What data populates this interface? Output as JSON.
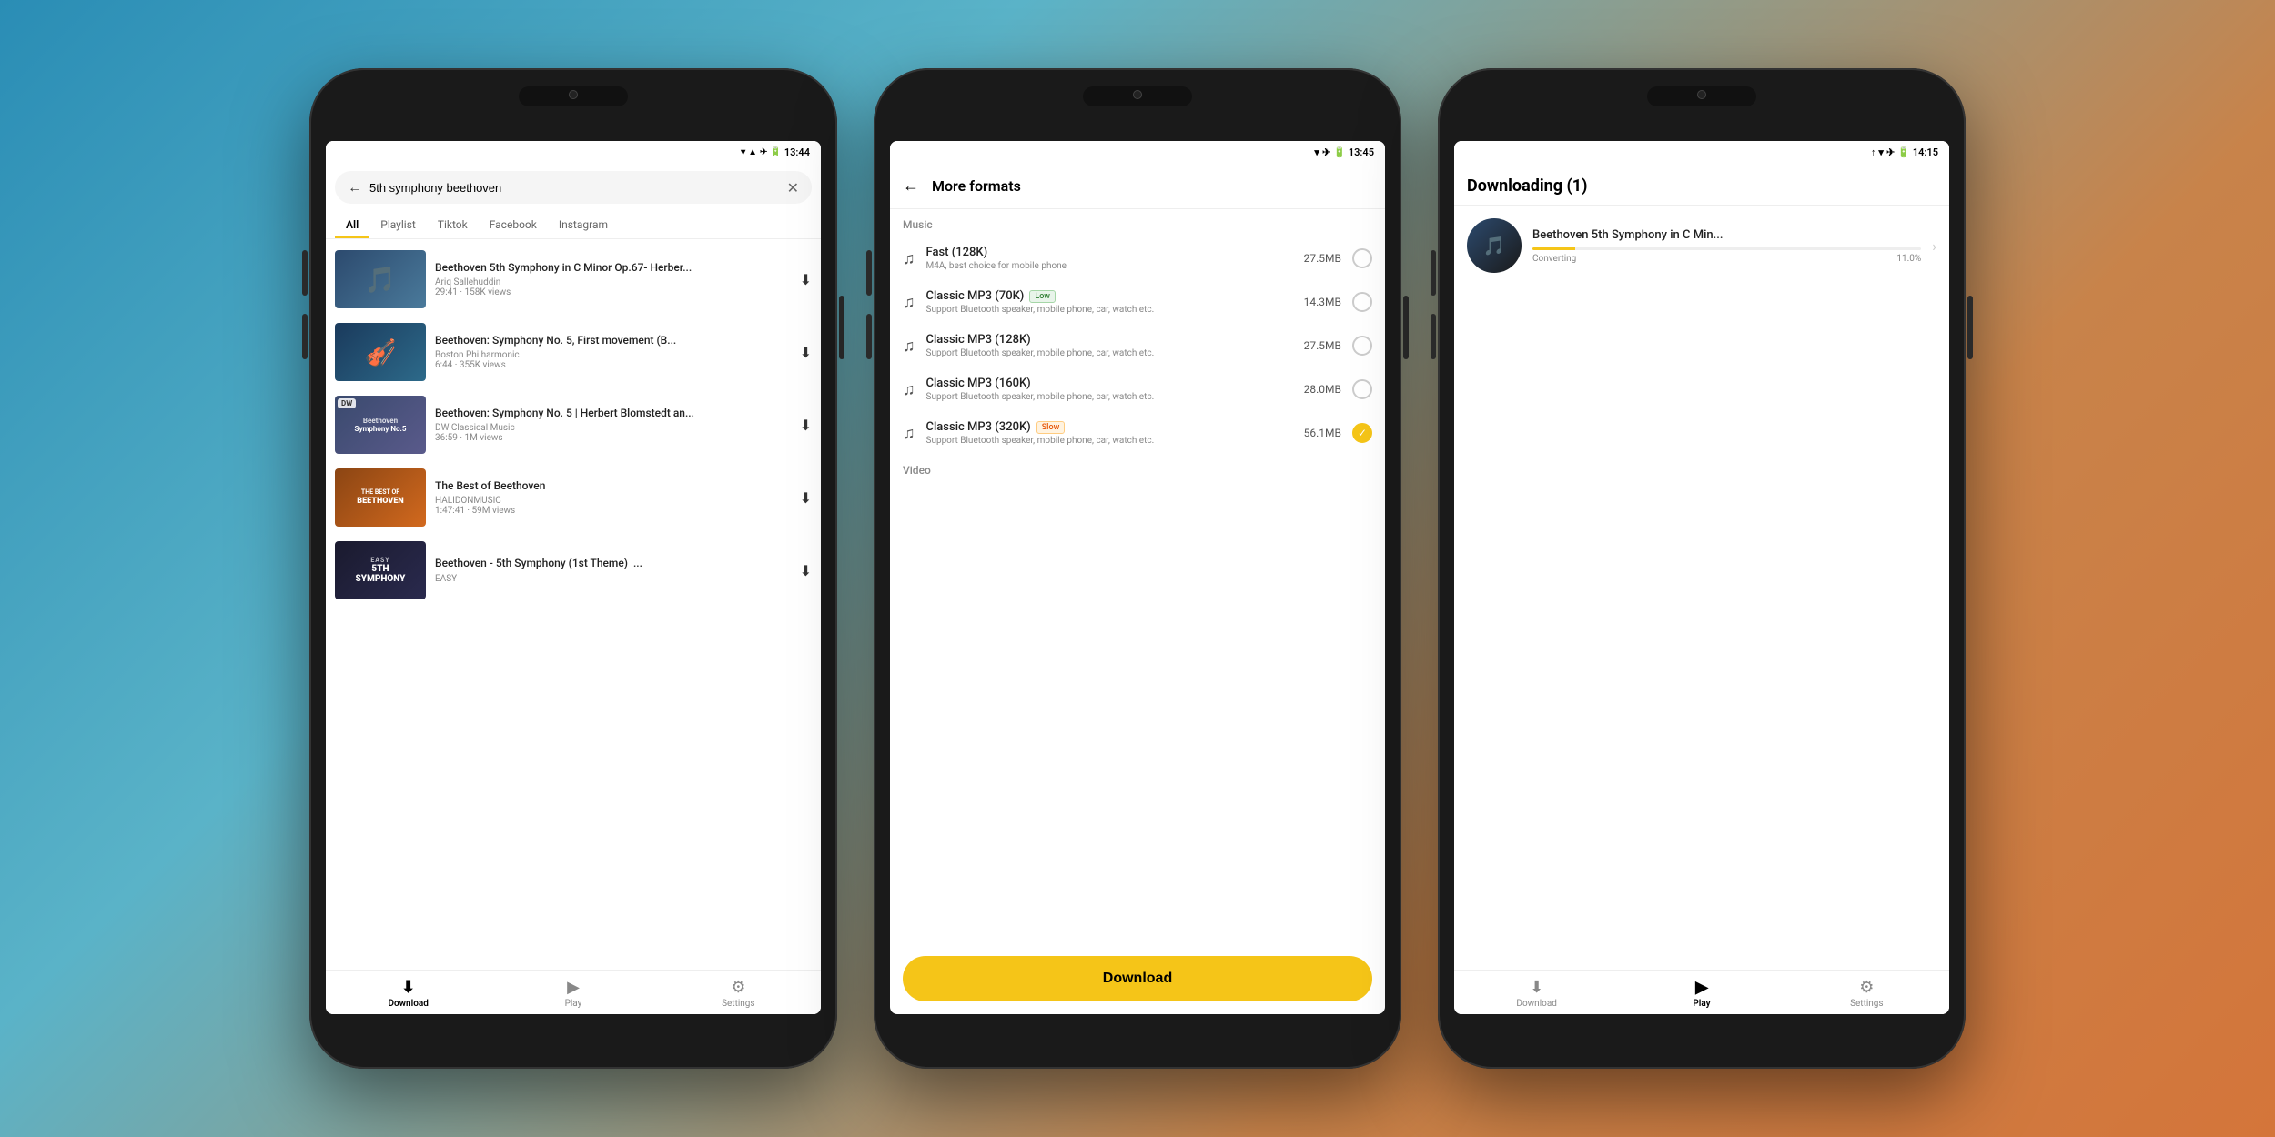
{
  "background": {
    "gradient_start": "#2a8db5",
    "gradient_end": "#d4753a"
  },
  "phone1": {
    "status_time": "13:44",
    "search_query": "5th symphony beethoven",
    "tabs": [
      "All",
      "Playlist",
      "Tiktok",
      "Facebook",
      "Instagram"
    ],
    "active_tab": "All",
    "results": [
      {
        "title": "Beethoven 5th Symphony in C Minor Op.67- Herber...",
        "channel": "Ariq Sallehuddin",
        "meta": "29:41 · 158K views",
        "thumb_style": "thumb-1",
        "thumb_icon": "🎵"
      },
      {
        "title": "Beethoven: Symphony No. 5, First movement (B...",
        "channel": "Boston Philharmonic",
        "meta": "6:44 · 355K views",
        "thumb_style": "thumb-2",
        "thumb_icon": "🎻"
      },
      {
        "title": "Beethoven: Symphony No. 5 | Herbert Blomstedt an...",
        "channel": "DW Classical Music",
        "meta": "36:59 · 1M views",
        "thumb_style": "thumb-3",
        "thumb_icon": "🎼",
        "badge": "DW"
      },
      {
        "title": "The Best of Beethoven",
        "channel": "HALIDONMUSIC",
        "meta": "1:47:41 · 59M views",
        "thumb_style": "thumb-4",
        "thumb_icon": "🎵",
        "thumb_text": "THE BEST OF\nBEETHOVEN"
      },
      {
        "title": "Beethoven - 5th Symphony (1st Theme) |...",
        "channel": "EASY",
        "meta": "",
        "thumb_style": "thumb-5",
        "thumb_icon": "🎵",
        "thumb_text": "5TH\nSYMPHONY"
      }
    ],
    "nav": {
      "items": [
        "Download",
        "Play",
        "Settings"
      ],
      "active": "Download",
      "icons": [
        "⬇",
        "▶",
        "⚙"
      ]
    }
  },
  "phone2": {
    "status_time": "13:45",
    "header_title": "More formats",
    "section_music": "Music",
    "section_video": "Video",
    "formats": [
      {
        "name": "Fast (128K)",
        "desc": "M4A, best choice for mobile phone",
        "size": "27.5MB",
        "badge": null,
        "selected": false
      },
      {
        "name": "Classic MP3 (70K)",
        "desc": "Support Bluetooth speaker, mobile phone, car, watch etc.",
        "size": "14.3MB",
        "badge": "Low",
        "badge_type": "low",
        "selected": false
      },
      {
        "name": "Classic MP3 (128K)",
        "desc": "Support Bluetooth speaker, mobile phone, car, watch etc.",
        "size": "27.5MB",
        "badge": null,
        "selected": false
      },
      {
        "name": "Classic MP3 (160K)",
        "desc": "Support Bluetooth speaker, mobile phone, car, watch etc.",
        "size": "28.0MB",
        "badge": null,
        "selected": false
      },
      {
        "name": "Classic MP3 (320K)",
        "desc": "Support Bluetooth speaker, mobile phone, car, watch etc.",
        "size": "56.1MB",
        "badge": "Slow",
        "badge_type": "slow",
        "selected": true
      }
    ],
    "download_btn": "Download"
  },
  "phone3": {
    "status_time": "14:15",
    "header_title": "Downloading (1)",
    "download_item": {
      "name": "Beethoven 5th Symphony in C Min...",
      "status": "Converting",
      "progress": 11.0,
      "progress_label": "11.0%"
    },
    "nav": {
      "items": [
        "Download",
        "Play",
        "Settings"
      ],
      "active": "Play",
      "icons": [
        "⬇",
        "▶",
        "⚙"
      ]
    }
  }
}
